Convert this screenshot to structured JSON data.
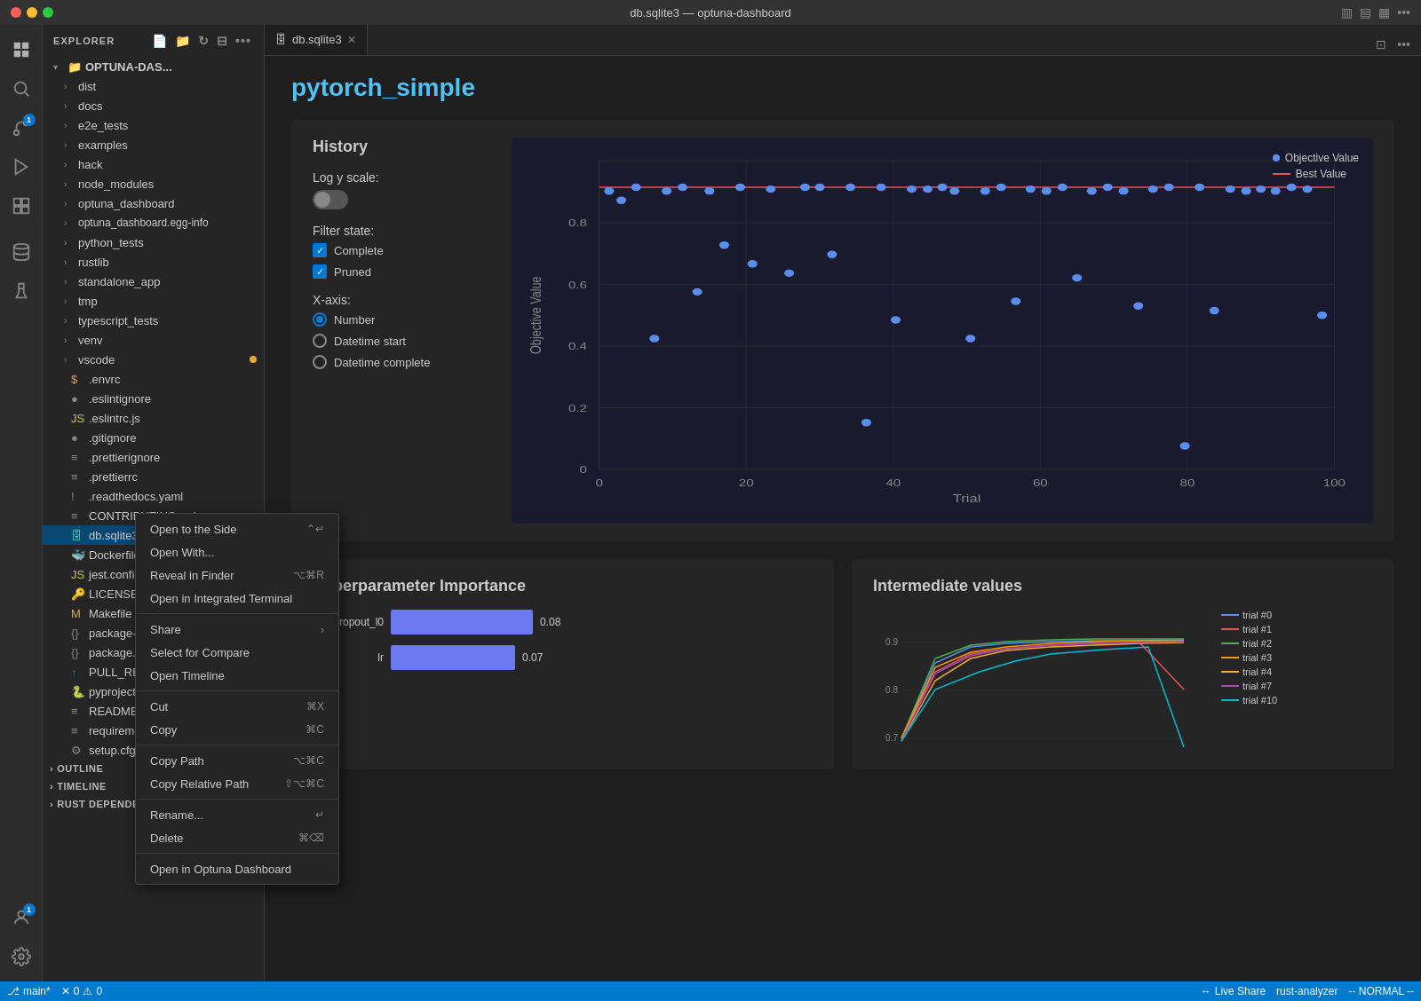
{
  "titlebar": {
    "title": "db.sqlite3 — optuna-dashboard",
    "dots": [
      "red",
      "yellow",
      "green"
    ]
  },
  "activityBar": {
    "items": [
      {
        "name": "explorer",
        "icon": "📄",
        "active": true
      },
      {
        "name": "search",
        "icon": "🔍",
        "active": false
      },
      {
        "name": "source-control",
        "icon": "⑂",
        "active": false,
        "badge": "1"
      },
      {
        "name": "run",
        "icon": "▷",
        "active": false
      },
      {
        "name": "extensions",
        "icon": "⊞",
        "active": false
      },
      {
        "name": "database",
        "icon": "🗄",
        "active": false
      },
      {
        "name": "flask",
        "icon": "⚗",
        "active": false
      }
    ],
    "bottomItems": [
      {
        "name": "accounts",
        "icon": "👤",
        "badge": "1"
      },
      {
        "name": "settings",
        "icon": "⚙"
      }
    ]
  },
  "sidebar": {
    "header": "EXPLORER",
    "root": "OPTUNA-DAS...",
    "treeItems": [
      {
        "label": "dist",
        "indent": 1,
        "type": "folder"
      },
      {
        "label": "docs",
        "indent": 1,
        "type": "folder"
      },
      {
        "label": "e2e_tests",
        "indent": 1,
        "type": "folder"
      },
      {
        "label": "examples",
        "indent": 1,
        "type": "folder"
      },
      {
        "label": "hack",
        "indent": 1,
        "type": "folder"
      },
      {
        "label": "node_modules",
        "indent": 1,
        "type": "folder"
      },
      {
        "label": "optuna_dashboard",
        "indent": 1,
        "type": "folder"
      },
      {
        "label": "optuna_dashboard.egg-info",
        "indent": 1,
        "type": "folder"
      },
      {
        "label": "python_tests",
        "indent": 1,
        "type": "folder"
      },
      {
        "label": "rustlib",
        "indent": 1,
        "type": "folder"
      },
      {
        "label": "standalone_app",
        "indent": 1,
        "type": "folder"
      },
      {
        "label": "tmp",
        "indent": 1,
        "type": "folder"
      },
      {
        "label": "typescript_tests",
        "indent": 1,
        "type": "folder"
      },
      {
        "label": "venv",
        "indent": 1,
        "type": "folder"
      },
      {
        "label": "vscode",
        "indent": 1,
        "type": "folder",
        "modified": true
      },
      {
        "label": ".envrc",
        "indent": 1,
        "type": "dollar-file"
      },
      {
        "label": ".eslintignore",
        "indent": 1,
        "type": "dot-file"
      },
      {
        "label": ".eslintrc.js",
        "indent": 1,
        "type": "dot-js"
      },
      {
        "label": ".gitignore",
        "indent": 1,
        "type": "dot-file"
      },
      {
        "label": ".prettierignore",
        "indent": 1,
        "type": "dot-file"
      },
      {
        "label": ".prettierrc",
        "indent": 1,
        "type": "dot-file"
      },
      {
        "label": ".readthedocs.yaml",
        "indent": 1,
        "type": "yaml"
      },
      {
        "label": "CONTRIBUTING.md",
        "indent": 1,
        "type": "md"
      },
      {
        "label": "db.sqlite3",
        "indent": 1,
        "type": "db",
        "selected": true
      },
      {
        "label": "Dockerfile",
        "indent": 1,
        "type": "docker"
      },
      {
        "label": "jest.config.js",
        "indent": 1,
        "type": "js"
      },
      {
        "label": "LICENSE",
        "indent": 1,
        "type": "license"
      },
      {
        "label": "Makefile",
        "indent": 1,
        "type": "make"
      },
      {
        "label": "package-lock.json",
        "indent": 1,
        "type": "json"
      },
      {
        "label": "package.json",
        "indent": 1,
        "type": "json"
      },
      {
        "label": "PULL_REQUEST...",
        "indent": 1,
        "type": "md"
      },
      {
        "label": "pyproject.toml",
        "indent": 1,
        "type": "toml"
      },
      {
        "label": "README.md",
        "indent": 1,
        "type": "md"
      },
      {
        "label": "requirements...",
        "indent": 1,
        "type": "txt"
      },
      {
        "label": "setup.cfg",
        "indent": 1,
        "type": "cfg"
      }
    ],
    "sections": [
      {
        "label": "OUTLINE"
      },
      {
        "label": "TIMELINE"
      },
      {
        "label": "RUST DEPENDE..."
      }
    ]
  },
  "tabs": [
    {
      "label": "db.sqlite3",
      "active": true,
      "icon": "🗄"
    }
  ],
  "editor": {
    "studyTitle": "pytorch_simple",
    "sections": {
      "history": {
        "title": "History",
        "logYScale": "Log y scale:",
        "logYEnabled": false,
        "filterState": "Filter state:",
        "filters": [
          {
            "label": "Complete",
            "checked": true
          },
          {
            "label": "Pruned",
            "checked": true
          }
        ],
        "xAxis": "X-axis:",
        "xAxisOptions": [
          {
            "label": "Number",
            "selected": true
          },
          {
            "label": "Datetime start",
            "selected": false
          },
          {
            "label": "Datetime complete",
            "selected": false
          }
        ]
      },
      "chart": {
        "legend": [
          {
            "label": "Objective Value",
            "type": "dot",
            "color": "#5b8dee"
          },
          {
            "label": "Best Value",
            "type": "line",
            "color": "#e05555"
          }
        ],
        "yLabel": "Objective Value",
        "xLabel": "Trial",
        "yTicks": [
          "0",
          "0.2",
          "0.4",
          "0.6",
          "0.8"
        ],
        "xTicks": [
          "0",
          "20",
          "40",
          "60",
          "80",
          "100"
        ]
      },
      "hyperparamImportance": {
        "title": "Hyperparameter Importance",
        "bars": [
          {
            "label": "dropout_l0",
            "value": 0.08
          },
          {
            "label": "lr",
            "value": 0.07
          }
        ]
      },
      "intermediateValues": {
        "title": "Intermediate values",
        "legend": [
          {
            "label": "trial #0",
            "color": "#5b8dee"
          },
          {
            "label": "trial #1",
            "color": "#e05555"
          },
          {
            "label": "trial #2",
            "color": "#4caf50"
          },
          {
            "label": "trial #3",
            "color": "#ff9800"
          },
          {
            "label": "trial #4",
            "color": "#f9a825"
          },
          {
            "label": "trial #7",
            "color": "#ab47bc"
          },
          {
            "label": "trial #10",
            "color": "#00bcd4"
          }
        ],
        "yTicks": [
          "0.7",
          "0.8",
          "0.9"
        ]
      }
    }
  },
  "contextMenu": {
    "items": [
      {
        "label": "Open to the Side",
        "shortcut": "⌃↵",
        "type": "item"
      },
      {
        "label": "Open With...",
        "shortcut": "",
        "type": "item"
      },
      {
        "label": "Reveal in Finder",
        "shortcut": "⌥⌘R",
        "type": "item"
      },
      {
        "label": "Open in Integrated Terminal",
        "shortcut": "",
        "type": "item"
      },
      {
        "type": "divider"
      },
      {
        "label": "Share",
        "shortcut": "",
        "type": "item",
        "hasArrow": true
      },
      {
        "label": "Select for Compare",
        "shortcut": "",
        "type": "item"
      },
      {
        "label": "Open Timeline",
        "shortcut": "",
        "type": "item"
      },
      {
        "type": "divider"
      },
      {
        "label": "Cut",
        "shortcut": "⌘X",
        "type": "item"
      },
      {
        "label": "Copy",
        "shortcut": "⌘C",
        "type": "item"
      },
      {
        "type": "divider"
      },
      {
        "label": "Copy Path",
        "shortcut": "⌥⌘C",
        "type": "item"
      },
      {
        "label": "Copy Relative Path",
        "shortcut": "⇧⌥⌘C",
        "type": "item"
      },
      {
        "type": "divider"
      },
      {
        "label": "Rename...",
        "shortcut": "↵",
        "type": "item"
      },
      {
        "label": "Delete",
        "shortcut": "⌘⌫",
        "type": "item"
      },
      {
        "type": "divider"
      },
      {
        "label": "Open in Optuna Dashboard",
        "shortcut": "",
        "type": "item"
      }
    ]
  },
  "statusBar": {
    "branch": "main*",
    "errors": "0",
    "warnings": "0",
    "liveShare": "Live Share",
    "rustAnalyzer": "rust-analyzer",
    "mode": "-- NORMAL --"
  }
}
